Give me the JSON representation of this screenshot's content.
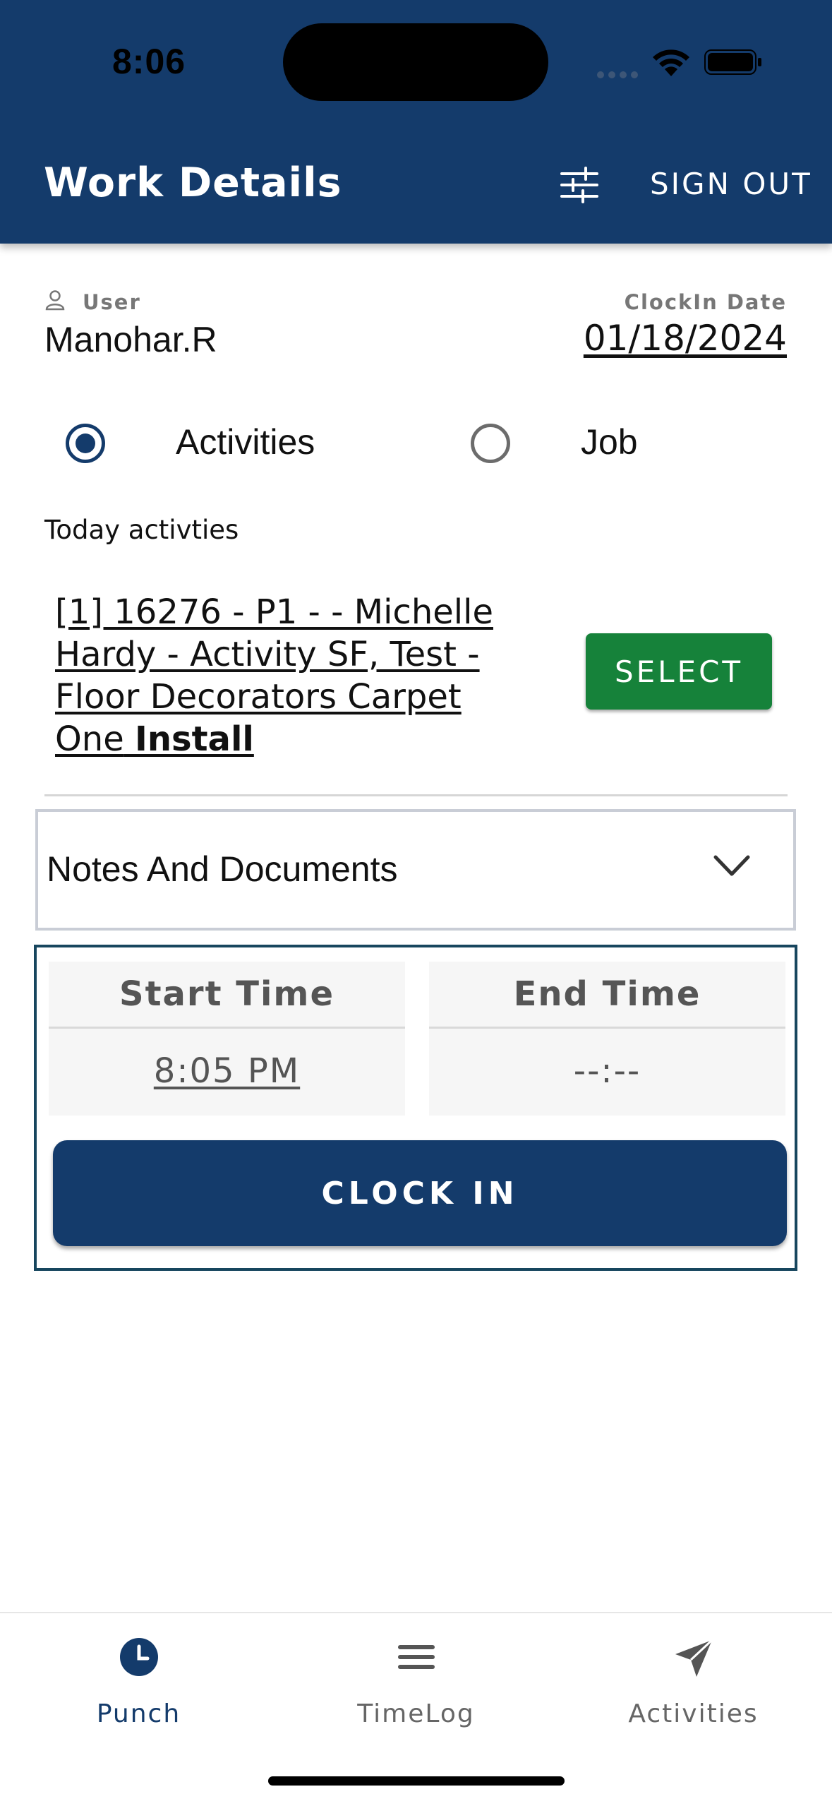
{
  "status_bar": {
    "time": "8:06"
  },
  "header": {
    "title": "Work Details",
    "filter_icon": "sliders-icon",
    "sign_out_label": "SIGN OUT"
  },
  "user": {
    "label": "User",
    "value": "Manohar.R",
    "icon": "person-icon"
  },
  "clockin_date": {
    "label": "ClockIn Date",
    "value": "01/18/2024"
  },
  "mode": {
    "options": [
      {
        "label": "Activities",
        "selected": true
      },
      {
        "label": "Job",
        "selected": false
      }
    ]
  },
  "today": {
    "label": "Today activties",
    "activity_text": "[1] 16276 - P1 - - Michelle Hardy - Activity SF, Test - Floor Decorators Carpet One",
    "activity_bold": "Install",
    "select_label": "SELECT"
  },
  "notes": {
    "label": "Notes And Documents",
    "icon": "chevron-down-icon"
  },
  "times": {
    "start_label": "Start Time",
    "start_value": "8:05 PM",
    "end_label": "End Time",
    "end_value": "--:--"
  },
  "clock_in_label": "CLOCK IN",
  "tabs": [
    {
      "label": "Punch",
      "icon": "clock-icon",
      "active": true
    },
    {
      "label": "TimeLog",
      "icon": "menu-icon",
      "active": false
    },
    {
      "label": "Activities",
      "icon": "send-icon",
      "active": false
    }
  ],
  "colors": {
    "primary": "#143b6b",
    "select_green": "#16823a",
    "panel_border": "#17465e"
  }
}
